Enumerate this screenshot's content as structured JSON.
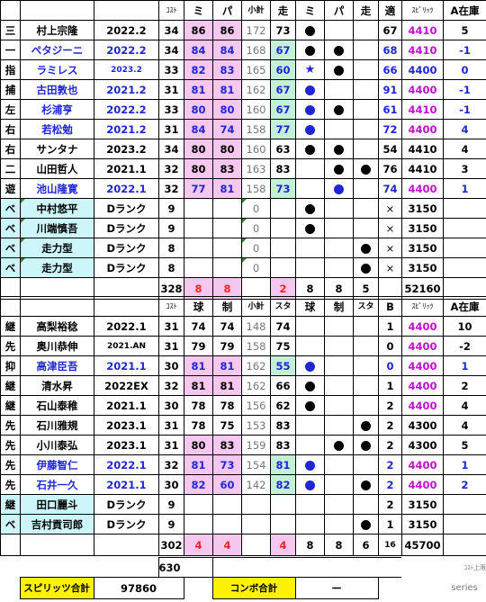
{
  "batters": {
    "header": {
      "cost": "ｺｽﾄ",
      "mi": "ミ",
      "pa": "パ",
      "subtotal": "小計",
      "run": "走",
      "mi2": "ミ",
      "pa2": "パ",
      "run2": "走",
      "fit": "適",
      "spirits": "ｽﾋﾟﾘｯﾂ",
      "stock": "A在庫"
    },
    "rows": [
      {
        "pos": "三",
        "name": "村上宗隆",
        "ver": "2022.2",
        "cost": "34",
        "mi": "86",
        "pa": "86",
        "sub": "172",
        "run": "73",
        "d1": "black",
        "d2": "",
        "d3": "",
        "fit": "67",
        "spirits": "4410",
        "stock": "5",
        "name_color": "black",
        "ver_color": "black",
        "fit_color": "black",
        "spirits_color": "magenta",
        "stock_color": "black",
        "pink": true,
        "mint": false
      },
      {
        "pos": "一",
        "name": "ペタジーニ",
        "ver": "2022.2",
        "cost": "34",
        "mi": "84",
        "pa": "84",
        "sub": "168",
        "run": "67",
        "d1": "black",
        "d2": "black",
        "d3": "",
        "fit": "68",
        "spirits": "4410",
        "stock": "-1",
        "name_color": "blue",
        "ver_color": "blue",
        "fit_color": "blue",
        "spirits_color": "magenta",
        "stock_color": "blue",
        "pink": true,
        "mint": true
      },
      {
        "pos": "指",
        "name": "ラミレス",
        "ver": "2023.2",
        "cost": "33",
        "mi": "82",
        "pa": "83",
        "sub": "165",
        "run": "60",
        "d1": "star",
        "d2": "black",
        "d3": "",
        "fit": "66",
        "spirits": "4400",
        "stock": "0",
        "name_color": "blue",
        "ver_color": "blue",
        "fit_color": "blue",
        "spirits_color": "blue",
        "stock_color": "blue",
        "pink": true,
        "mint": true
      },
      {
        "pos": "捕",
        "name": "古田敦也",
        "ver": "2021.2",
        "cost": "31",
        "mi": "81",
        "pa": "81",
        "sub": "162",
        "run": "67",
        "d1": "blue",
        "d2": "",
        "d3": "",
        "fit": "91",
        "spirits": "4400",
        "stock": "-1",
        "name_color": "blue",
        "ver_color": "blue",
        "fit_color": "blue",
        "spirits_color": "magenta",
        "stock_color": "blue",
        "pink": true,
        "mint": true
      },
      {
        "pos": "左",
        "name": "杉浦亨",
        "ver": "2022.2",
        "cost": "33",
        "mi": "80",
        "pa": "80",
        "sub": "160",
        "run": "67",
        "d1": "blue",
        "d2": "black",
        "d3": "",
        "fit": "61",
        "spirits": "4410",
        "stock": "-1",
        "name_color": "blue",
        "ver_color": "blue",
        "fit_color": "blue",
        "spirits_color": "magenta",
        "stock_color": "blue",
        "pink": true,
        "mint": true
      },
      {
        "pos": "右",
        "name": "若松勉",
        "ver": "2021.2",
        "cost": "31",
        "mi": "84",
        "pa": "74",
        "sub": "158",
        "run": "77",
        "d1": "blue",
        "d2": "",
        "d3": "",
        "fit": "72",
        "spirits": "4400",
        "stock": "4",
        "name_color": "blue",
        "ver_color": "blue",
        "fit_color": "blue",
        "spirits_color": "magenta",
        "stock_color": "blue",
        "pink": true,
        "mint": true
      },
      {
        "pos": "右",
        "name": "サンタナ",
        "ver": "2023.2",
        "cost": "34",
        "mi": "80",
        "pa": "80",
        "sub": "160",
        "run": "63",
        "d1": "black",
        "d2": "black",
        "d3": "",
        "fit": "54",
        "spirits": "4410",
        "stock": "4",
        "name_color": "black",
        "ver_color": "black",
        "fit_color": "black",
        "spirits_color": "black",
        "stock_color": "black",
        "pink": true,
        "mint": false
      },
      {
        "pos": "二",
        "name": "山田哲人",
        "ver": "2021.1",
        "cost": "32",
        "mi": "80",
        "pa": "83",
        "sub": "163",
        "run": "83",
        "d1": "",
        "d2": "black",
        "d3": "black",
        "fit": "76",
        "spirits": "4410",
        "stock": "3",
        "name_color": "black",
        "ver_color": "black",
        "fit_color": "black",
        "spirits_color": "black",
        "stock_color": "black",
        "pink": true,
        "mint": false
      },
      {
        "pos": "遊",
        "name": "池山隆寛",
        "ver": "2022.1",
        "cost": "32",
        "mi": "77",
        "pa": "81",
        "sub": "158",
        "run": "73",
        "d1": "",
        "d2": "blue",
        "d3": "",
        "fit": "74",
        "spirits": "4400",
        "stock": "1",
        "name_color": "blue",
        "ver_color": "blue",
        "fit_color": "blue",
        "spirits_color": "magenta",
        "stock_color": "blue",
        "pink": true,
        "mint": true
      },
      {
        "pos": "ベ",
        "name": "中村悠平",
        "ver": "Dランク",
        "cost": "9",
        "mi": "",
        "pa": "",
        "sub": "0",
        "run": "",
        "d1": "black",
        "d2": "",
        "d3": "",
        "fit": "×",
        "spirits": "3150",
        "stock": "",
        "name_color": "black",
        "ver_color": "black",
        "fit_color": "black",
        "spirits_color": "black",
        "stock_color": "black",
        "pink": false,
        "mint": false,
        "cyan": true
      },
      {
        "pos": "ベ",
        "name": "川端慎吾",
        "ver": "Dランク",
        "cost": "9",
        "mi": "",
        "pa": "",
        "sub": "0",
        "run": "",
        "d1": "black",
        "d2": "",
        "d3": "",
        "fit": "×",
        "spirits": "3150",
        "stock": "",
        "name_color": "black",
        "ver_color": "black",
        "fit_color": "black",
        "spirits_color": "black",
        "stock_color": "black",
        "pink": false,
        "mint": false,
        "cyan": true
      },
      {
        "pos": "ベ",
        "name": "走力型",
        "ver": "Dランク",
        "cost": "8",
        "mi": "",
        "pa": "",
        "sub": "0",
        "run": "",
        "d1": "",
        "d2": "",
        "d3": "black",
        "fit": "×",
        "spirits": "3150",
        "stock": "",
        "name_color": "black",
        "ver_color": "black",
        "fit_color": "black",
        "spirits_color": "black",
        "stock_color": "black",
        "pink": false,
        "mint": false,
        "cyan": true
      },
      {
        "pos": "ベ",
        "name": "走力型",
        "ver": "Dランク",
        "cost": "8",
        "mi": "",
        "pa": "",
        "sub": "0",
        "run": "",
        "d1": "",
        "d2": "",
        "d3": "black",
        "fit": "×",
        "spirits": "3150",
        "stock": "",
        "name_color": "black",
        "ver_color": "black",
        "fit_color": "black",
        "spirits_color": "black",
        "stock_color": "black",
        "pink": false,
        "mint": false,
        "cyan": true
      }
    ],
    "totals": {
      "cost": "328",
      "mi": "8",
      "pa": "8",
      "sub": "",
      "run": "2",
      "c1": "8",
      "c2": "8",
      "c3": "5",
      "spirits": "52160"
    }
  },
  "pitchers": {
    "header": {
      "cost": "ｺｽﾄ",
      "ball": "球",
      "ctrl": "制",
      "subtotal": "小計",
      "sta": "スタ",
      "ball2": "球",
      "ctrl2": "制",
      "sta2": "スタ",
      "b": "B",
      "spirits": "ｽﾋﾟﾘｯﾂ",
      "stock": "A在庫"
    },
    "rows": [
      {
        "pos": "継",
        "name": "高梨裕稔",
        "ver": "2022.1",
        "cost": "31",
        "ball": "74",
        "ctrl": "74",
        "sub": "148",
        "sta": "74",
        "d1": "",
        "d2": "",
        "d3": "",
        "b": "1",
        "spirits": "4400",
        "stock": "10",
        "name_color": "black",
        "ver_color": "black",
        "b_color": "black",
        "spirits_color": "magenta",
        "stock_color": "black",
        "pink": false,
        "mint": false
      },
      {
        "pos": "先",
        "name": "奥川恭伸",
        "ver": "2021.AN",
        "cost": "31",
        "ball": "79",
        "ctrl": "79",
        "sub": "158",
        "sta": "75",
        "d1": "",
        "d2": "",
        "d3": "",
        "b": "0",
        "spirits": "4400",
        "stock": "-2",
        "name_color": "black",
        "ver_color": "black",
        "b_color": "black",
        "spirits_color": "magenta",
        "stock_color": "black",
        "pink": false,
        "mint": false
      },
      {
        "pos": "抑",
        "name": "高津臣吾",
        "ver": "2021.1",
        "cost": "30",
        "ball": "81",
        "ctrl": "81",
        "sub": "162",
        "sta": "55",
        "d1": "blue",
        "d2": "",
        "d3": "",
        "b": "0",
        "spirits": "4400",
        "stock": "1",
        "name_color": "blue",
        "ver_color": "blue",
        "b_color": "blue",
        "spirits_color": "magenta",
        "stock_color": "blue",
        "pink": true,
        "mint": true
      },
      {
        "pos": "継",
        "name": "清水昇",
        "ver": "2022EX",
        "cost": "32",
        "ball": "81",
        "ctrl": "81",
        "sub": "162",
        "sta": "66",
        "d1": "black",
        "d2": "",
        "d3": "",
        "b": "1",
        "spirits": "4400",
        "stock": "2",
        "name_color": "black",
        "ver_color": "black",
        "b_color": "black",
        "spirits_color": "magenta",
        "stock_color": "black",
        "pink": true,
        "mint": false
      },
      {
        "pos": "継",
        "name": "石山泰稚",
        "ver": "2021.1",
        "cost": "30",
        "ball": "78",
        "ctrl": "78",
        "sub": "156",
        "sta": "62",
        "d1": "black",
        "d2": "",
        "d3": "",
        "b": "2",
        "spirits": "4400",
        "stock": "4",
        "name_color": "black",
        "ver_color": "black",
        "b_color": "black",
        "spirits_color": "magenta",
        "stock_color": "black",
        "pink": false,
        "mint": false
      },
      {
        "pos": "先",
        "name": "石川雅規",
        "ver": "2023.1",
        "cost": "31",
        "ball": "78",
        "ctrl": "75",
        "sub": "153",
        "sta": "83",
        "d1": "",
        "d2": "",
        "d3": "black",
        "b": "2",
        "spirits": "4300",
        "stock": "4",
        "name_color": "black",
        "ver_color": "black",
        "b_color": "black",
        "spirits_color": "black",
        "stock_color": "black",
        "pink": false,
        "mint": false
      },
      {
        "pos": "先",
        "name": "小川泰弘",
        "ver": "2023.1",
        "cost": "31",
        "ball": "80",
        "ctrl": "83",
        "sub": "159",
        "sta": "83",
        "d1": "",
        "d2": "black",
        "d3": "black",
        "b": "2",
        "spirits": "4300",
        "stock": "5",
        "name_color": "black",
        "ver_color": "black",
        "b_color": "black",
        "spirits_color": "black",
        "stock_color": "black",
        "pink": true,
        "mint": false
      },
      {
        "pos": "先",
        "name": "伊藤智仁",
        "ver": "2022.1",
        "cost": "32",
        "ball": "81",
        "ctrl": "73",
        "sub": "154",
        "sta": "81",
        "d1": "blue",
        "d2": "",
        "d3": "",
        "b": "2",
        "spirits": "4400",
        "stock": "1",
        "name_color": "blue",
        "ver_color": "blue",
        "b_color": "blue",
        "spirits_color": "magenta",
        "stock_color": "blue",
        "pink": true,
        "mint": true
      },
      {
        "pos": "先",
        "name": "石井一久",
        "ver": "2021.1",
        "cost": "30",
        "ball": "82",
        "ctrl": "60",
        "sub": "142",
        "sta": "82",
        "d1": "blue",
        "d2": "",
        "d3": "black",
        "b": "2",
        "spirits": "4400",
        "stock": "2",
        "name_color": "blue",
        "ver_color": "blue",
        "b_color": "blue",
        "spirits_color": "magenta",
        "stock_color": "blue",
        "pink": true,
        "mint": true
      },
      {
        "pos": "継",
        "name": "田口麗斗",
        "ver": "Dランク",
        "cost": "9",
        "ball": "",
        "ctrl": "",
        "sub": "",
        "sta": "",
        "d1": "",
        "d2": "",
        "d3": "",
        "b": "2",
        "spirits": "3150",
        "stock": "",
        "name_color": "black",
        "ver_color": "black",
        "b_color": "black",
        "spirits_color": "black",
        "stock_color": "black",
        "pink": false,
        "mint": false,
        "cyan": true
      },
      {
        "pos": "ベ",
        "name": "吉村貢司郎",
        "ver": "Dランク",
        "cost": "9",
        "ball": "",
        "ctrl": "",
        "sub": "",
        "sta": "",
        "d1": "",
        "d2": "",
        "d3": "black",
        "b": "1",
        "spirits": "3150",
        "stock": "",
        "name_color": "black",
        "ver_color": "black",
        "b_color": "black",
        "spirits_color": "black",
        "stock_color": "black",
        "pink": false,
        "mint": false,
        "cyan": true
      }
    ],
    "totals": {
      "cost": "302",
      "ball": "4",
      "ctrl": "4",
      "sub": "",
      "sta": "4",
      "c1": "8",
      "c2": "8",
      "c3": "6",
      "b": "16",
      "spirits": "45700"
    }
  },
  "summary": {
    "cost_total": "630",
    "cost_limit_label": "ｺｽﾄ上限",
    "spirits_label": "スピリッツ合計",
    "spirits_value": "97860",
    "combo_label": "コンボ合計",
    "combo_value": "ー",
    "series_label": "series"
  },
  "colors": {
    "pink": "#f6c8f0",
    "mint": "#c3f0d6",
    "cyan": "#cdf6fb",
    "blue": "#1e26d6",
    "magenta": "#c00fd0",
    "red": "#ff2020",
    "yellow": "#fff200"
  }
}
